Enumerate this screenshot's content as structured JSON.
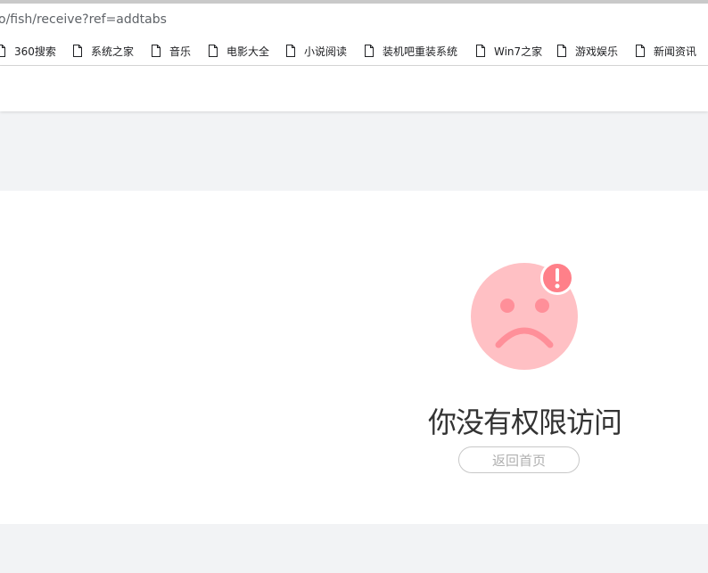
{
  "browser": {
    "url": "o/fish/receive?ref=addtabs",
    "bookmarks": [
      {
        "label": "360搜索",
        "icon": "file-icon"
      },
      {
        "label": "系统之家",
        "icon": "file-icon"
      },
      {
        "label": "音乐",
        "icon": "file-icon"
      },
      {
        "label": "电影大全",
        "icon": "file-icon"
      },
      {
        "label": "小说阅读",
        "icon": "file-icon"
      },
      {
        "label": "装机吧重装系统",
        "icon": "file-icon"
      },
      {
        "label": "Win7之家",
        "icon": "file-icon"
      },
      {
        "label": "游戏娱乐",
        "icon": "file-icon"
      },
      {
        "label": "新闻资讯",
        "icon": "file-icon"
      }
    ]
  },
  "error_page": {
    "title": "你没有权限访问",
    "home_button_label": "返回首页",
    "illustration": "sad-face-icon",
    "badge": "alert-icon"
  },
  "colors": {
    "face": "#ffc0c4",
    "face_features": "#ff8f99",
    "badge": "#ff8089",
    "title_text": "#333333",
    "button_text": "#b0b0b0",
    "page_bg": "#f2f3f5"
  }
}
